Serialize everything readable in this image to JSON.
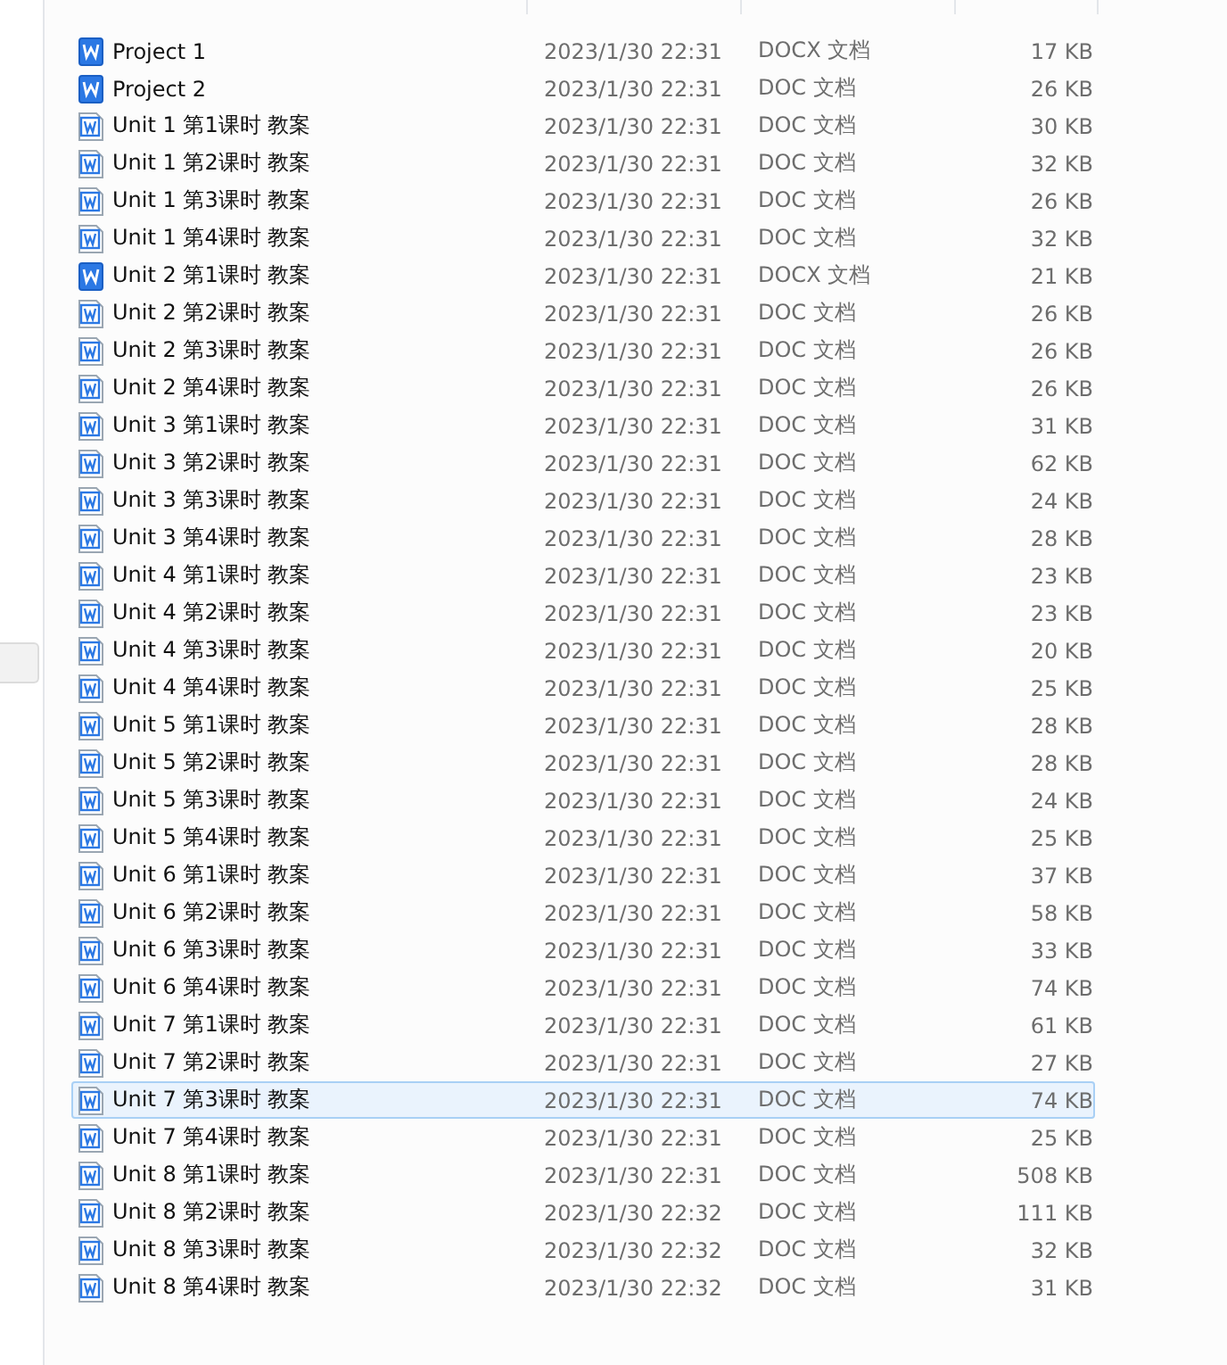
{
  "files": [
    {
      "name": "Project 1",
      "modified": "2023/1/30 22:31",
      "type": "DOCX 文档",
      "size": "17 KB",
      "kind": "docx",
      "selected": false
    },
    {
      "name": "Project 2",
      "modified": "2023/1/30 22:31",
      "type": "DOC 文档",
      "size": "26 KB",
      "kind": "docx",
      "selected": false
    },
    {
      "name": "Unit 1 第1课时 教案",
      "modified": "2023/1/30 22:31",
      "type": "DOC 文档",
      "size": "30 KB",
      "kind": "doc",
      "selected": false
    },
    {
      "name": "Unit 1 第2课时 教案",
      "modified": "2023/1/30 22:31",
      "type": "DOC 文档",
      "size": "32 KB",
      "kind": "doc",
      "selected": false
    },
    {
      "name": "Unit 1 第3课时 教案",
      "modified": "2023/1/30 22:31",
      "type": "DOC 文档",
      "size": "26 KB",
      "kind": "doc",
      "selected": false
    },
    {
      "name": "Unit 1 第4课时 教案",
      "modified": "2023/1/30 22:31",
      "type": "DOC 文档",
      "size": "32 KB",
      "kind": "doc",
      "selected": false
    },
    {
      "name": "Unit 2 第1课时 教案",
      "modified": "2023/1/30 22:31",
      "type": "DOCX 文档",
      "size": "21 KB",
      "kind": "docx",
      "selected": false
    },
    {
      "name": "Unit 2 第2课时 教案",
      "modified": "2023/1/30 22:31",
      "type": "DOC 文档",
      "size": "26 KB",
      "kind": "doc",
      "selected": false
    },
    {
      "name": "Unit 2 第3课时 教案",
      "modified": "2023/1/30 22:31",
      "type": "DOC 文档",
      "size": "26 KB",
      "kind": "doc",
      "selected": false
    },
    {
      "name": "Unit 2 第4课时 教案",
      "modified": "2023/1/30 22:31",
      "type": "DOC 文档",
      "size": "26 KB",
      "kind": "doc",
      "selected": false
    },
    {
      "name": "Unit 3 第1课时 教案",
      "modified": "2023/1/30 22:31",
      "type": "DOC 文档",
      "size": "31 KB",
      "kind": "doc",
      "selected": false
    },
    {
      "name": "Unit 3 第2课时 教案",
      "modified": "2023/1/30 22:31",
      "type": "DOC 文档",
      "size": "62 KB",
      "kind": "doc",
      "selected": false
    },
    {
      "name": "Unit 3 第3课时 教案",
      "modified": "2023/1/30 22:31",
      "type": "DOC 文档",
      "size": "24 KB",
      "kind": "doc",
      "selected": false
    },
    {
      "name": "Unit 3 第4课时 教案",
      "modified": "2023/1/30 22:31",
      "type": "DOC 文档",
      "size": "28 KB",
      "kind": "doc",
      "selected": false
    },
    {
      "name": "Unit 4 第1课时 教案",
      "modified": "2023/1/30 22:31",
      "type": "DOC 文档",
      "size": "23 KB",
      "kind": "doc",
      "selected": false
    },
    {
      "name": "Unit 4 第2课时 教案",
      "modified": "2023/1/30 22:31",
      "type": "DOC 文档",
      "size": "23 KB",
      "kind": "doc",
      "selected": false
    },
    {
      "name": "Unit 4 第3课时 教案",
      "modified": "2023/1/30 22:31",
      "type": "DOC 文档",
      "size": "20 KB",
      "kind": "doc",
      "selected": false
    },
    {
      "name": "Unit 4 第4课时 教案",
      "modified": "2023/1/30 22:31",
      "type": "DOC 文档",
      "size": "25 KB",
      "kind": "doc",
      "selected": false
    },
    {
      "name": "Unit 5 第1课时 教案",
      "modified": "2023/1/30 22:31",
      "type": "DOC 文档",
      "size": "28 KB",
      "kind": "doc",
      "selected": false
    },
    {
      "name": "Unit 5 第2课时 教案",
      "modified": "2023/1/30 22:31",
      "type": "DOC 文档",
      "size": "28 KB",
      "kind": "doc",
      "selected": false
    },
    {
      "name": "Unit 5 第3课时 教案",
      "modified": "2023/1/30 22:31",
      "type": "DOC 文档",
      "size": "24 KB",
      "kind": "doc",
      "selected": false
    },
    {
      "name": "Unit 5 第4课时 教案",
      "modified": "2023/1/30 22:31",
      "type": "DOC 文档",
      "size": "25 KB",
      "kind": "doc",
      "selected": false
    },
    {
      "name": "Unit 6 第1课时 教案",
      "modified": "2023/1/30 22:31",
      "type": "DOC 文档",
      "size": "37 KB",
      "kind": "doc",
      "selected": false
    },
    {
      "name": "Unit 6 第2课时 教案",
      "modified": "2023/1/30 22:31",
      "type": "DOC 文档",
      "size": "58 KB",
      "kind": "doc",
      "selected": false
    },
    {
      "name": "Unit 6 第3课时 教案",
      "modified": "2023/1/30 22:31",
      "type": "DOC 文档",
      "size": "33 KB",
      "kind": "doc",
      "selected": false
    },
    {
      "name": "Unit 6 第4课时 教案",
      "modified": "2023/1/30 22:31",
      "type": "DOC 文档",
      "size": "74 KB",
      "kind": "doc",
      "selected": false
    },
    {
      "name": "Unit 7 第1课时 教案",
      "modified": "2023/1/30 22:31",
      "type": "DOC 文档",
      "size": "61 KB",
      "kind": "doc",
      "selected": false
    },
    {
      "name": "Unit 7 第2课时 教案",
      "modified": "2023/1/30 22:31",
      "type": "DOC 文档",
      "size": "27 KB",
      "kind": "doc",
      "selected": false
    },
    {
      "name": "Unit 7 第3课时 教案",
      "modified": "2023/1/30 22:31",
      "type": "DOC 文档",
      "size": "74 KB",
      "kind": "doc",
      "selected": true
    },
    {
      "name": "Unit 7 第4课时 教案",
      "modified": "2023/1/30 22:31",
      "type": "DOC 文档",
      "size": "25 KB",
      "kind": "doc",
      "selected": false
    },
    {
      "name": "Unit 8 第1课时 教案",
      "modified": "2023/1/30 22:31",
      "type": "DOC 文档",
      "size": "508 KB",
      "kind": "doc",
      "selected": false
    },
    {
      "name": "Unit 8 第2课时 教案",
      "modified": "2023/1/30 22:32",
      "type": "DOC 文档",
      "size": "111 KB",
      "kind": "doc",
      "selected": false
    },
    {
      "name": "Unit 8 第3课时 教案",
      "modified": "2023/1/30 22:32",
      "type": "DOC 文档",
      "size": "32 KB",
      "kind": "doc",
      "selected": false
    },
    {
      "name": "Unit 8 第4课时 教案",
      "modified": "2023/1/30 22:32",
      "type": "DOC 文档",
      "size": "31 KB",
      "kind": "doc",
      "selected": false
    }
  ]
}
